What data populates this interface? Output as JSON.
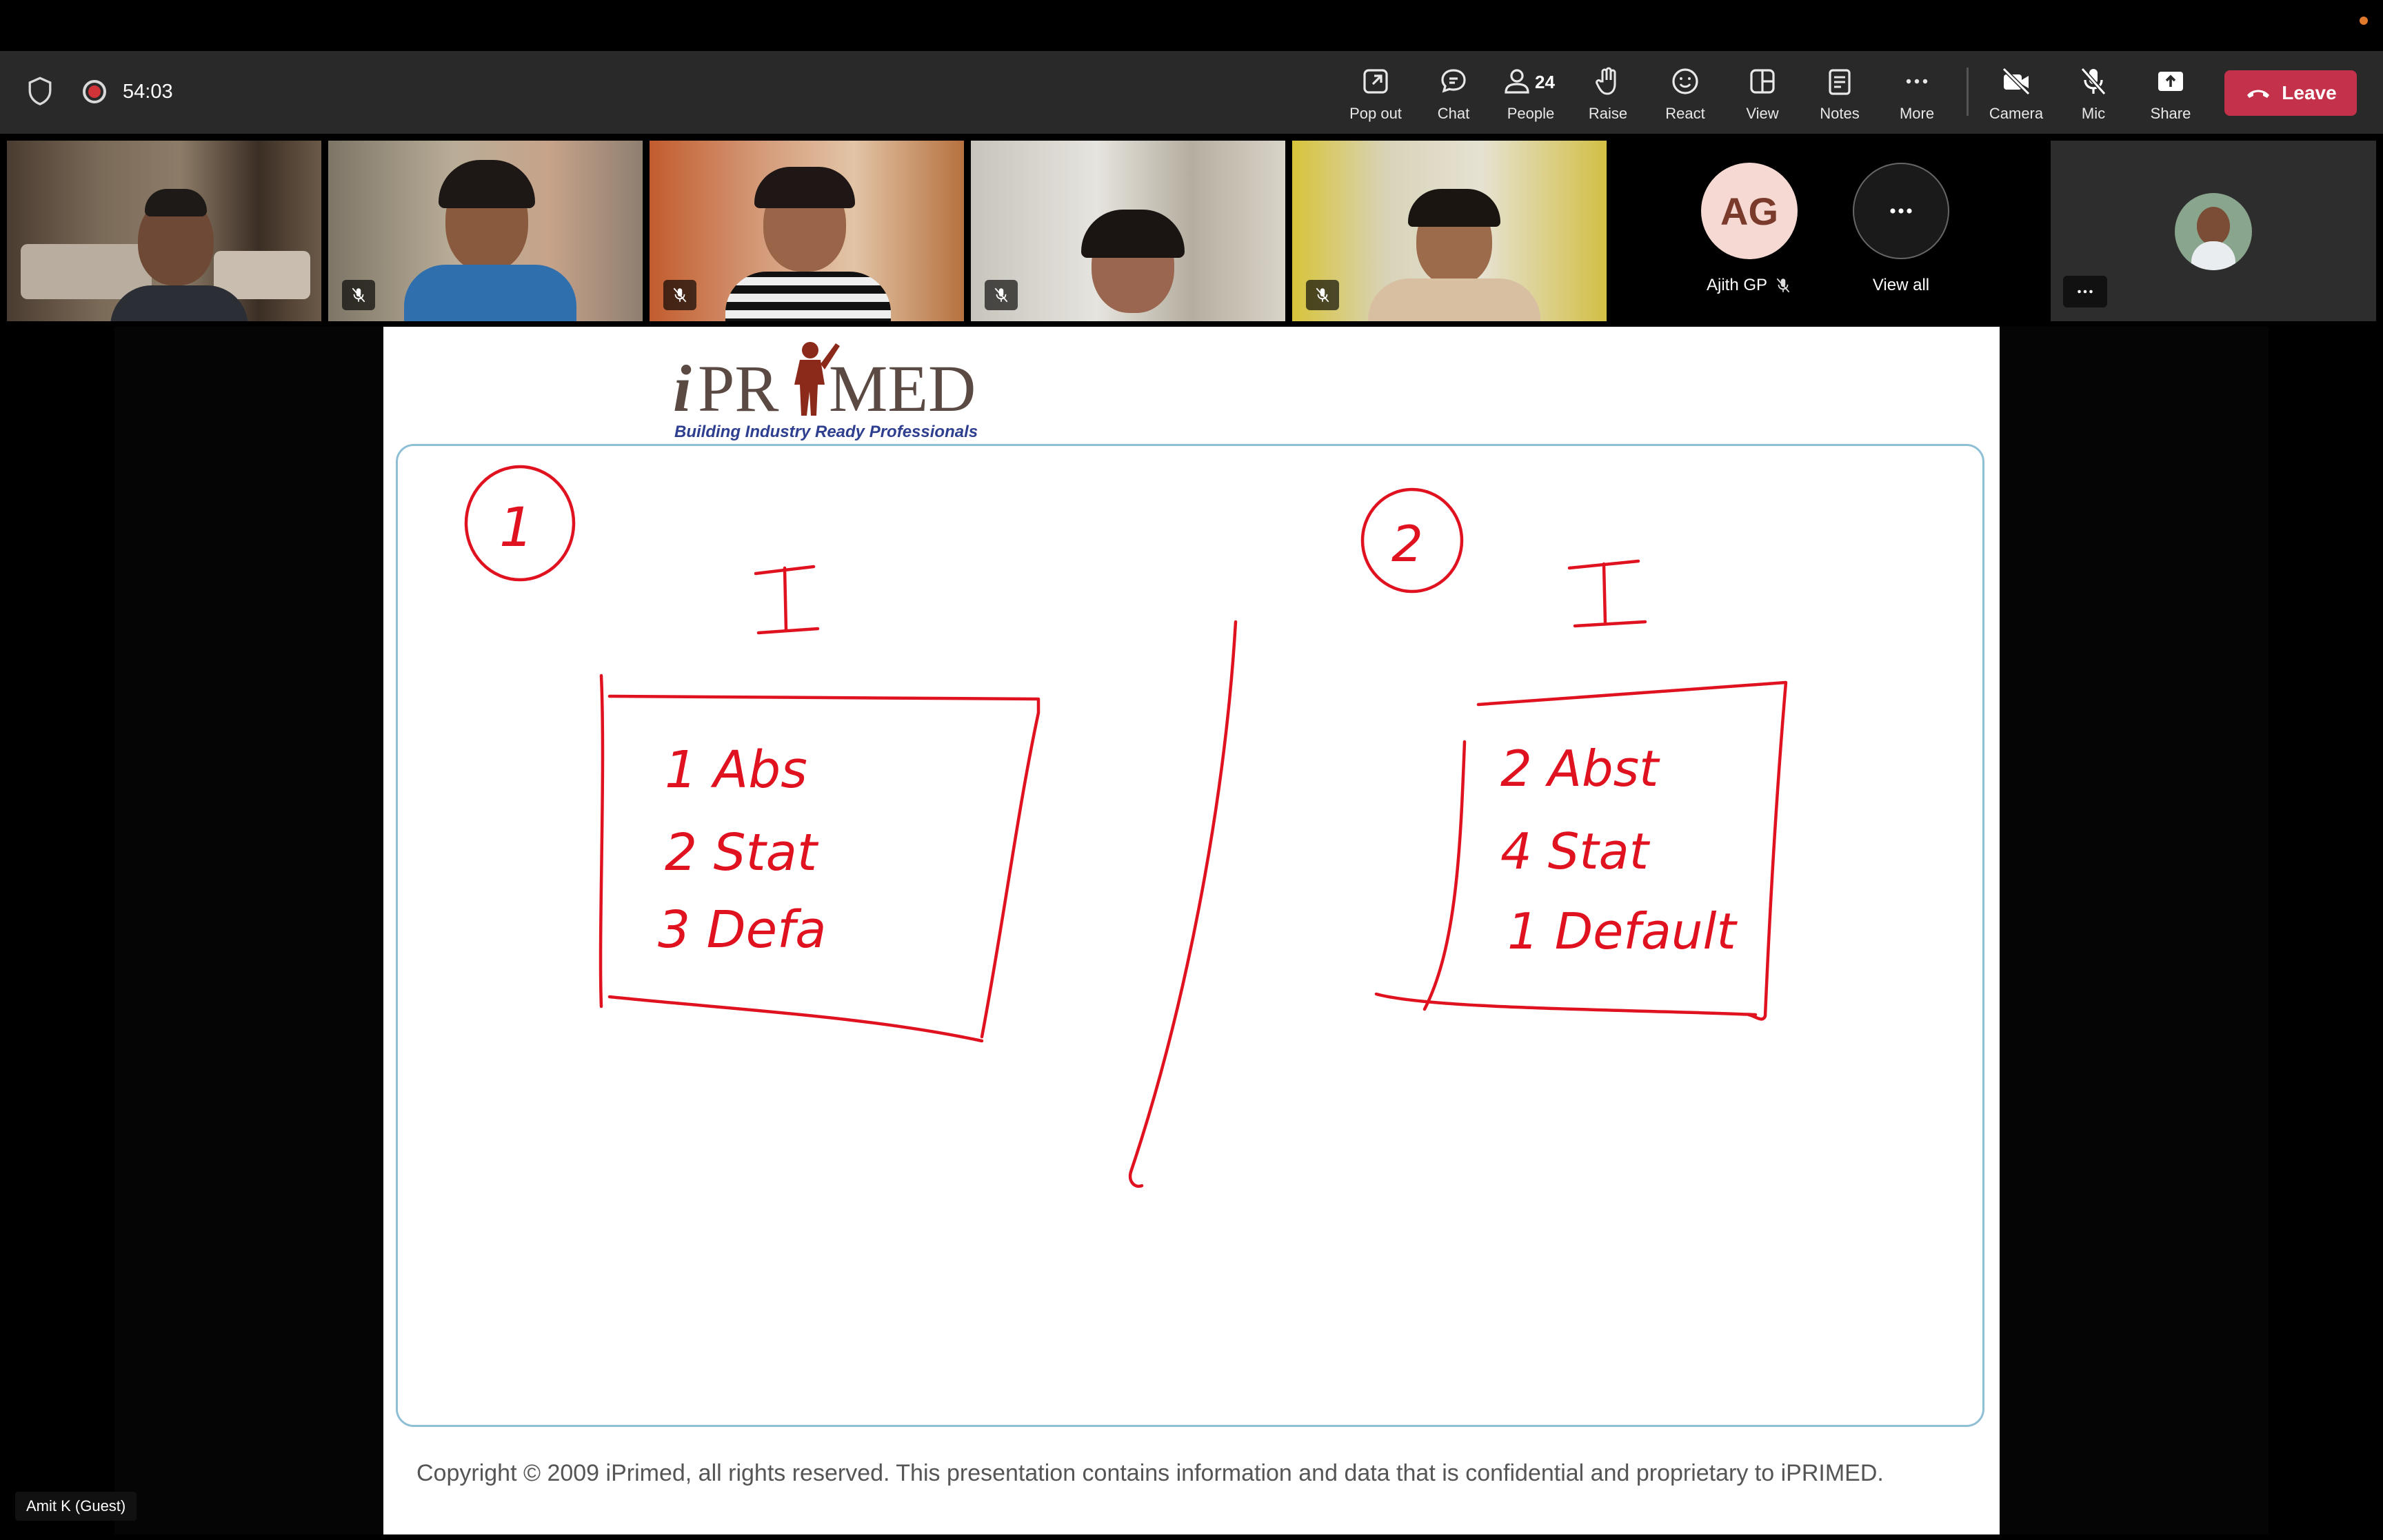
{
  "meeting": {
    "timer": "54:03"
  },
  "toolbar": {
    "pop_out": "Pop out",
    "chat": "Chat",
    "people": "People",
    "people_count": "24",
    "raise": "Raise",
    "react": "React",
    "view": "View",
    "notes": "Notes",
    "more": "More",
    "camera": "Camera",
    "mic": "Mic",
    "share": "Share",
    "leave": "Leave"
  },
  "participants": {
    "ag_initials": "AG",
    "ag_name": "Ajith GP",
    "view_all": "View all"
  },
  "slide": {
    "logo_text": "iPRIMED",
    "logo_tagline": "Building Industry Ready Professionals",
    "copyright": "Copyright © 2009 iPrimed, all rights reserved. This presentation contains information  and data  that is confidential and proprietary to iPRIMED.",
    "handwriting": {
      "left": {
        "number": "1",
        "header": "I",
        "lines": [
          "1 Abs",
          "2 Stat",
          "3 Defa"
        ]
      },
      "right": {
        "number": "2",
        "header": "I",
        "lines": [
          "2 Abst",
          "4 Stat",
          "1 Default"
        ]
      }
    }
  },
  "presenter_label": "Amit K (Guest)",
  "colors": {
    "leave": "#c4314b",
    "ink": "#e0121f",
    "recording": "#d13438"
  }
}
